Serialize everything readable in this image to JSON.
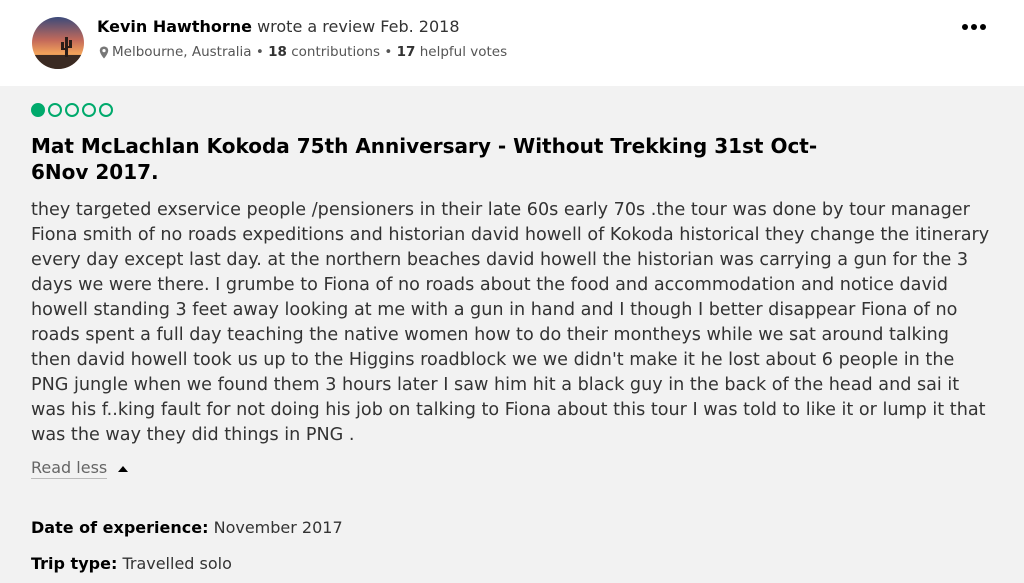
{
  "reviewer": {
    "name": "Kevin Hawthorne",
    "action": "wrote a review Feb. 2018",
    "location": "Melbourne, Australia",
    "contributions_count": "18",
    "contributions_label": "contributions",
    "helpful_count": "17",
    "helpful_label": "helpful votes",
    "separator": "•"
  },
  "review": {
    "rating": 1,
    "rating_max": 5,
    "title": "Mat McLachlan Kokoda 75th Anniversary - Without Trekking 31st Oct-6Nov 2017.",
    "body": "they targeted exservice people /pensioners in their late 60s early 70s .the tour was done by tour manager Fiona smith of no roads expeditions and historian david howell of Kokoda historical they change the itinerary every day except last day. at the northern beaches david howell the historian was carrying a gun for the 3 days we were there. I grumbe to Fiona of no roads about the food and accommodation and notice david howell standing 3 feet away looking at me with a gun in hand and I though I better disappear Fiona of no roads spent a full day teaching the native women how to do their montheys while we sat around talking then david howell took us up to the Higgins roadblock we we didn't make it he lost about 6 people in the PNG jungle when we found them 3 hours later I saw him hit a black guy in the back of the head and sai it was his f..king fault for not doing his job on talking to Fiona about this tour I was told to like it or lump it that was the way they did things in PNG .",
    "read_less_label": "Read less",
    "date_of_experience_label": "Date of experience:",
    "date_of_experience_value": "November 2017",
    "trip_type_label": "Trip type:",
    "trip_type_value": "Travelled solo"
  },
  "colors": {
    "rating_green": "#00aa6c",
    "header_bg": "#ffffff",
    "page_bg": "#f2f2f2"
  },
  "icons": {
    "more": "more-options-icon",
    "location": "location-pin-icon",
    "read_less_caret": "caret-up-icon"
  }
}
